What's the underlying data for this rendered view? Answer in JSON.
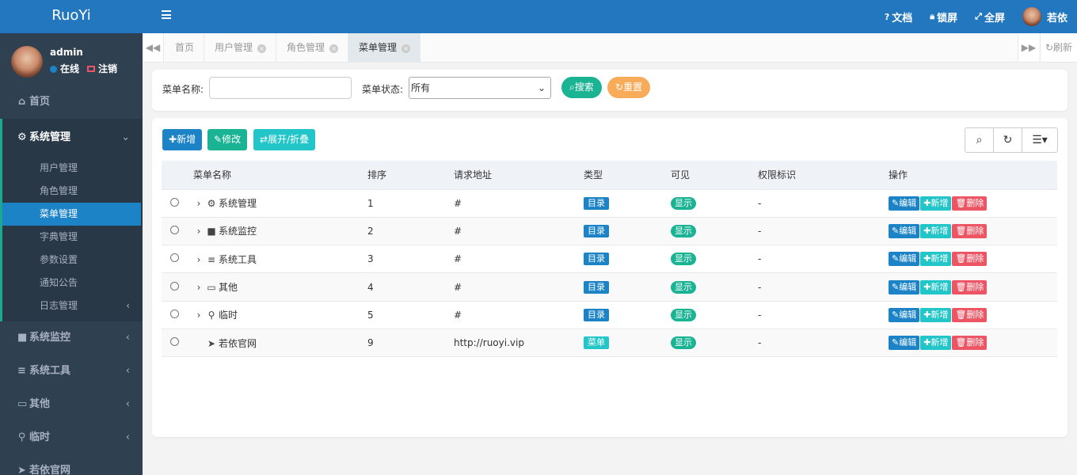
{
  "app": {
    "logo": "RuoYi"
  },
  "user": {
    "name": "admin",
    "status": "在线",
    "logout": "注销"
  },
  "sidebar": {
    "items": [
      {
        "label": "首页"
      },
      {
        "label": "系统管理"
      },
      {
        "label": "系统监控"
      },
      {
        "label": "系统工具"
      },
      {
        "label": "其他"
      },
      {
        "label": "临时"
      },
      {
        "label": "若依官网"
      }
    ],
    "sub": [
      {
        "label": "用户管理"
      },
      {
        "label": "角色管理"
      },
      {
        "label": "菜单管理"
      },
      {
        "label": "字典管理"
      },
      {
        "label": "参数设置"
      },
      {
        "label": "通知公告"
      },
      {
        "label": "日志管理"
      }
    ]
  },
  "topbar": {
    "doc": "文档",
    "lock": "锁屏",
    "fullscreen": "全屏",
    "username": "若依"
  },
  "tabs": [
    {
      "label": "首页"
    },
    {
      "label": "用户管理"
    },
    {
      "label": "角色管理"
    },
    {
      "label": "菜单管理"
    }
  ],
  "refresh": "刷新",
  "search": {
    "name_label": "菜单名称:",
    "name_value": "",
    "status_label": "菜单状态:",
    "status_value": "所有",
    "search_btn": "搜索",
    "reset_btn": "重置"
  },
  "toolbar": {
    "add": "新增",
    "edit": "修改",
    "toggle": "展开/折叠"
  },
  "table": {
    "headers": [
      "菜单名称",
      "排序",
      "请求地址",
      "类型",
      "可见",
      "权限标识",
      "操作"
    ],
    "rows": [
      {
        "name": "系统管理",
        "icon": "gear-icon",
        "order": "1",
        "url": "#",
        "type": "目录",
        "visible": "显示",
        "perm": "-"
      },
      {
        "name": "系统监控",
        "icon": "video-icon",
        "order": "2",
        "url": "#",
        "type": "目录",
        "visible": "显示",
        "perm": "-"
      },
      {
        "name": "系统工具",
        "icon": "bars-icon",
        "order": "3",
        "url": "#",
        "type": "目录",
        "visible": "显示",
        "perm": "-"
      },
      {
        "name": "其他",
        "icon": "desktop-icon",
        "order": "4",
        "url": "#",
        "type": "目录",
        "visible": "显示",
        "perm": "-"
      },
      {
        "name": "临时",
        "icon": "map-marker-icon",
        "order": "5",
        "url": "#",
        "type": "目录",
        "visible": "显示",
        "perm": "-"
      },
      {
        "name": "若依官网",
        "icon": "location-arrow-icon",
        "order": "9",
        "url": "http://ruoyi.vip",
        "type": "菜单",
        "visible": "显示",
        "perm": "-"
      }
    ],
    "actions": {
      "edit": "编辑",
      "add": "新增",
      "delete": "删除"
    }
  },
  "colors": {
    "primary": "#1c84c6",
    "teal": "#1ab394",
    "info": "#23c6c8",
    "warning": "#f8ac59",
    "danger": "#ed5565",
    "sidebar": "#2f4050",
    "header": "#2277bf"
  }
}
